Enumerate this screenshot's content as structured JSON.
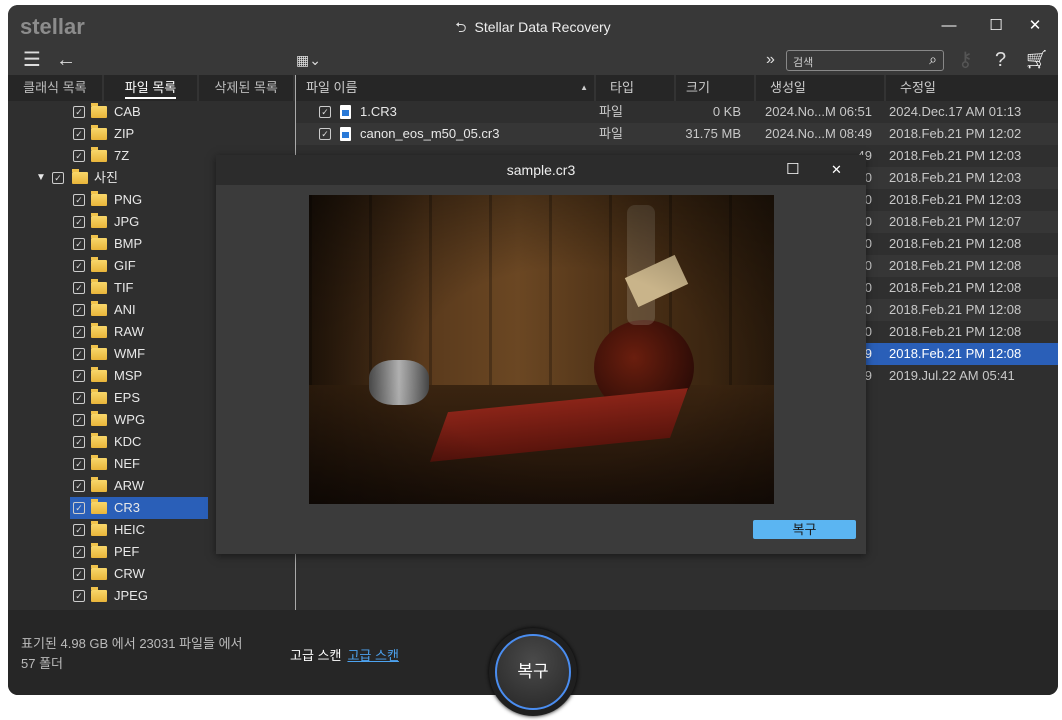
{
  "app": {
    "logo": "stellar",
    "title": "Stellar Data Recovery"
  },
  "window_controls": {
    "minimize": "—",
    "maximize": "☐",
    "close": "✕"
  },
  "toolbar": {
    "menu_icon": "☰",
    "back_icon": "←",
    "view_icon": "▦⌄",
    "expand_icon": "»",
    "search_placeholder": "검색",
    "search_icon": "⌕",
    "key_icon": "⚷",
    "help_icon": "?",
    "cart_icon": "🛒"
  },
  "tabs": [
    {
      "label": "클래식 목록"
    },
    {
      "label": "파일 목록",
      "active": true
    },
    {
      "label": "삭제된 목록"
    }
  ],
  "tree": {
    "top_items": [
      "CAB",
      "ZIP",
      "7Z"
    ],
    "parent": "사진",
    "children": [
      "PNG",
      "JPG",
      "BMP",
      "GIF",
      "TIF",
      "ANI",
      "RAW",
      "WMF",
      "MSP",
      "EPS",
      "WPG",
      "KDC",
      "NEF",
      "ARW",
      "CR3",
      "HEIC",
      "PEF",
      "CRW",
      "JPEG"
    ],
    "selected": "CR3"
  },
  "columns": {
    "name": "파일 이름",
    "type": "타입",
    "size": "크기",
    "created": "생성일",
    "modified": "수정일"
  },
  "rows": [
    {
      "name": "1.CR3",
      "type": "파일",
      "size": "0  KB",
      "created": "2024.No...M 06:51",
      "modified": "2024.Dec.17 AM 01:13"
    },
    {
      "name": "canon_eos_m50_05.cr3",
      "type": "파일",
      "size": "31.75 MB",
      "created": "2024.No...M 08:49",
      "modified": "2018.Feb.21 PM 12:02"
    },
    {
      "created": "49",
      "modified": "2018.Feb.21 PM 12:03"
    },
    {
      "created": "50",
      "modified": "2018.Feb.21 PM 12:03"
    },
    {
      "created": "50",
      "modified": "2018.Feb.21 PM 12:03"
    },
    {
      "created": "50",
      "modified": "2018.Feb.21 PM 12:07"
    },
    {
      "created": "50",
      "modified": "2018.Feb.21 PM 12:08"
    },
    {
      "created": "50",
      "modified": "2018.Feb.21 PM 12:08"
    },
    {
      "created": "50",
      "modified": "2018.Feb.21 PM 12:08"
    },
    {
      "created": "50",
      "modified": "2018.Feb.21 PM 12:08"
    },
    {
      "created": "50",
      "modified": "2018.Feb.21 PM 12:08"
    },
    {
      "created": "49",
      "modified": "2018.Feb.21 PM 12:08",
      "selected": true
    },
    {
      "created": "49",
      "modified": "2019.Jul.22 AM 05:41"
    }
  ],
  "dialog": {
    "title": "sample.cr3",
    "recover": "복구"
  },
  "status": {
    "summary": "표기된 4.98 GB 에서 23031 파일들 에서 57 폴더",
    "deep_scan_label": "고급 스캔",
    "deep_scan_link": "고급 스캔",
    "recover": "복구"
  },
  "colors": {
    "accent": "#4a8df0",
    "selection": "#2a5fb8",
    "dialog_button": "#5bb5f2"
  }
}
